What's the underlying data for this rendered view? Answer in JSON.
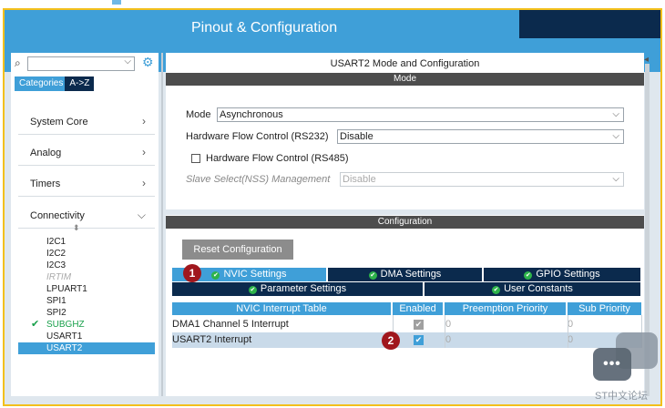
{
  "header": {
    "title": "Pinout & Configuration"
  },
  "sidebar": {
    "tabs": [
      "Categories",
      "A->Z"
    ],
    "categories": [
      {
        "label": "System Core",
        "arrow": ">"
      },
      {
        "label": "Analog",
        "arrow": ">"
      },
      {
        "label": "Timers",
        "arrow": ">"
      },
      {
        "label": "Connectivity",
        "arrow": "v"
      }
    ],
    "connectivity": [
      "I2C1",
      "I2C2",
      "I2C3",
      "IRTIM",
      "LPUART1",
      "SPI1",
      "SPI2",
      "SUBGHZ",
      "USART1",
      "USART2"
    ]
  },
  "mode": {
    "title": "USART2 Mode and Configuration",
    "section": "Mode",
    "mode_label": "Mode",
    "mode_value": "Asynchronous",
    "hw_flow_label": "Hardware Flow Control (RS232)",
    "hw_flow_value": "Disable",
    "rs485_label": "Hardware Flow Control (RS485)",
    "nss_label": "Slave Select(NSS) Management",
    "nss_value": "Disable"
  },
  "config": {
    "section": "Configuration",
    "reset_label": "Reset Configuration",
    "tabs_row1": [
      "NVIC Settings",
      "DMA Settings",
      "GPIO Settings"
    ],
    "tabs_row2": [
      "Parameter Settings",
      "User Constants"
    ],
    "table_headers": [
      "NVIC Interrupt Table",
      "Enabled",
      "Preemption Priority",
      "Sub Priority"
    ],
    "rows": [
      {
        "name": "DMA1 Channel 5 Interrupt",
        "enabled": true,
        "preemption": "0",
        "sub": "0"
      },
      {
        "name": "USART2 Interrupt",
        "enabled": true,
        "preemption": "0",
        "sub": "0"
      }
    ]
  },
  "annotations": [
    "1",
    "2"
  ],
  "watermark": "ST中文论坛"
}
